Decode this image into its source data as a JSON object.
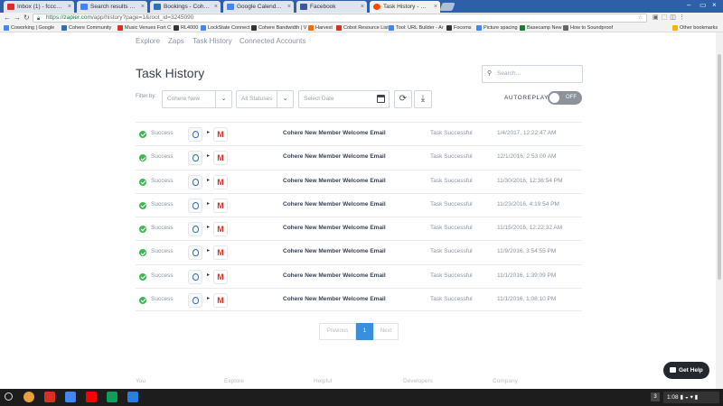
{
  "browser": {
    "tabs": [
      {
        "label": "Inbox (1) - fcccoworking@",
        "color": "#d93025"
      },
      {
        "label": "Search results - Google",
        "color": "#4285f4"
      },
      {
        "label": "Bookings - Cohere",
        "color": "#2f6fb3"
      },
      {
        "label": "Google Calendar - Tue, N",
        "color": "#4285f4"
      },
      {
        "label": "Facebook",
        "color": "#3b5998"
      },
      {
        "label": "Task History - Zapier",
        "color": "#ff4a00"
      }
    ],
    "url_host": "https://zapier.com",
    "url_path": "/app/history?page=1&root_id=3245090",
    "bookmarks": [
      {
        "label": "Coworking | Google",
        "color": "#4285f4"
      },
      {
        "label": "Cohere Community",
        "color": "#2f6fb3"
      },
      {
        "label": "Music Venues Fort C",
        "color": "#d93025"
      },
      {
        "label": "RL4000",
        "color": "#333333"
      },
      {
        "label": "LockState Connect",
        "color": "#4285f4"
      },
      {
        "label": "Cohere Bandwidth | V",
        "color": "#333333"
      },
      {
        "label": "Harvest",
        "color": "#f36c00"
      },
      {
        "label": "Cobot Resource List",
        "color": "#d93025"
      },
      {
        "label": "Tool: URL Builder - Ar",
        "color": "#4285f4"
      },
      {
        "label": "Focoms",
        "color": "#333333"
      },
      {
        "label": "Picture spacing",
        "color": "#4285f4"
      },
      {
        "label": "Basecamp New",
        "color": "#1e7b34"
      },
      {
        "label": "How to Soundproof",
        "color": "#666666"
      },
      {
        "label": "Other bookmarks",
        "color": "#f4b400"
      }
    ]
  },
  "subnav": {
    "items": [
      "Explore",
      "Zaps",
      "Task History",
      "Connected Accounts"
    ]
  },
  "page": {
    "title": "Task History",
    "search_placeholder": "Search...",
    "filter_label": "Filter by:",
    "filter_zap": "Cohere New",
    "filter_status": "All Statuses",
    "filter_date": "Select Date",
    "autoreplay_label": "AUTOREPLAY",
    "autoreplay_state": "OFF"
  },
  "tasks": [
    {
      "status": "Success",
      "zap": "Cohere New Member Welcome Email",
      "result": "Task Successful",
      "date": "1/4/2017, 12:22:47 AM"
    },
    {
      "status": "Success",
      "zap": "Cohere New Member Welcome Email",
      "result": "Task Successful",
      "date": "12/1/2016, 2:53:00 AM"
    },
    {
      "status": "Success",
      "zap": "Cohere New Member Welcome Email",
      "result": "Task Successful",
      "date": "11/30/2016, 12:36:54 PM"
    },
    {
      "status": "Success",
      "zap": "Cohere New Member Welcome Email",
      "result": "Task Successful",
      "date": "11/23/2016, 4:19:54 PM"
    },
    {
      "status": "Success",
      "zap": "Cohere New Member Welcome Email",
      "result": "Task Successful",
      "date": "11/15/2016, 12:22:32 AM"
    },
    {
      "status": "Success",
      "zap": "Cohere New Member Welcome Email",
      "result": "Task Successful",
      "date": "11/9/2016, 3:54:55 PM"
    },
    {
      "status": "Success",
      "zap": "Cohere New Member Welcome Email",
      "result": "Task Successful",
      "date": "11/1/2016, 1:39:09 PM"
    },
    {
      "status": "Success",
      "zap": "Cohere New Member Welcome Email",
      "result": "Task Successful",
      "date": "11/1/2016, 1:08:10 PM"
    }
  ],
  "pagination": {
    "previous": "Previous",
    "current": "1",
    "next": "Next"
  },
  "footer": [
    "You",
    "Explore",
    "Helpful",
    "Developers",
    "Company"
  ],
  "help_button": "Get Help",
  "shelf": {
    "apps": [
      {
        "name": "chrome",
        "color": "#e9a23b"
      },
      {
        "name": "gmail",
        "color": "#d93025"
      },
      {
        "name": "docs",
        "color": "#4285f4"
      },
      {
        "name": "youtube",
        "color": "#ff0000"
      },
      {
        "name": "drive",
        "color": "#0f9d58"
      },
      {
        "name": "files",
        "color": "#2a7de1"
      }
    ],
    "badge": "3",
    "clock": "1:08"
  },
  "colors": {
    "success": "#3fb950",
    "accent": "#3a8fd9",
    "gmail": "#d93025"
  }
}
